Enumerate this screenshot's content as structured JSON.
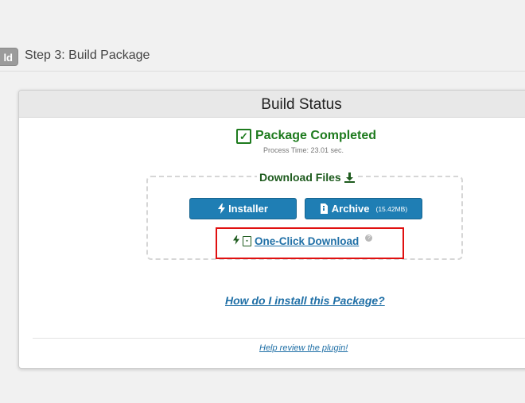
{
  "step": {
    "badge": "ld",
    "title": "Step 3: Build Package"
  },
  "panel": {
    "title": "Build Status",
    "status": "Package Completed",
    "process_time": "Process Time: 23.01 sec.",
    "download_title": "Download Files",
    "installer_label": "Installer",
    "archive_label": "Archive",
    "archive_size": "(15.42MB)",
    "one_click_label": "One-Click Download",
    "help_glyph": "?",
    "howto_link": "How do I install this Package?",
    "review_link": "Help review the plugin!"
  },
  "icons": {
    "check": "check-square-icon",
    "download": "download-icon",
    "bolt": "bolt-icon",
    "archive": "file-archive-icon",
    "file": "file-zip-icon",
    "help": "question-circle-icon"
  },
  "colors": {
    "success": "#1e7b1e",
    "button": "#1f7eb4",
    "link": "#1f6fa6",
    "highlight": "#e01010"
  }
}
